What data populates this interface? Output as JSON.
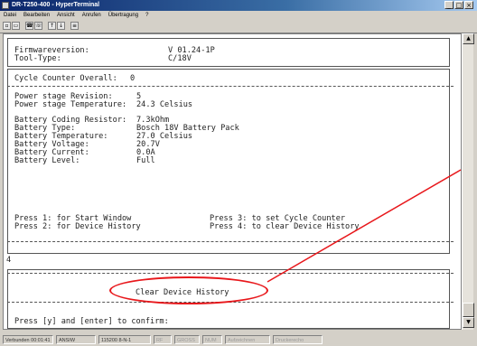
{
  "window": {
    "title": "DR-T250-400 - HyperTerminal"
  },
  "menu": [
    "Datei",
    "Bearbeiten",
    "Ansicht",
    "Anrufen",
    "Übertragung",
    "?"
  ],
  "terminal": {
    "header": [
      {
        "label": "Firmwareversion:",
        "value": "V 01.24-1P"
      },
      {
        "label": "Tool-Type:",
        "value": "C/18V"
      }
    ],
    "cycle_counter": {
      "label": "Cycle Counter Overall:",
      "value": "0"
    },
    "power_stage": [
      {
        "label": "Power stage Revision:",
        "value": "5"
      },
      {
        "label": "Power stage Temperature:",
        "value": "24.3 Celsius"
      }
    ],
    "battery": [
      {
        "label": "Battery Coding Resistor:",
        "value": "7.3kOhm"
      },
      {
        "label": "Battery Type:",
        "value": "Bosch 18V Battery Pack"
      },
      {
        "label": "Battery Temperature:",
        "value": "27.0 Celsius"
      },
      {
        "label": "Battery Voltage:",
        "value": "20.7V"
      },
      {
        "label": "Battery Current:",
        "value": "0.0A"
      },
      {
        "label": "Battery Level:",
        "value": "Full"
      }
    ],
    "options": [
      {
        "left": "Press 1: for Start Window",
        "right": "Press 3: to set Cycle Counter"
      },
      {
        "left": "Press 2: for Device History",
        "right": "Press 4: to clear Device History"
      }
    ],
    "input_echo": "4",
    "dialog_title": "Clear Device History",
    "confirm_prompt": "Press [y] and [enter] to confirm:"
  },
  "statusbar": [
    "Verbunden 00:01:41",
    "ANSIW",
    "115200 8-N-1",
    "RF",
    "GROSS",
    "NUM",
    "Aufzeichnen",
    "Druckerecho"
  ],
  "annotation": {
    "color": "#e8171b"
  }
}
